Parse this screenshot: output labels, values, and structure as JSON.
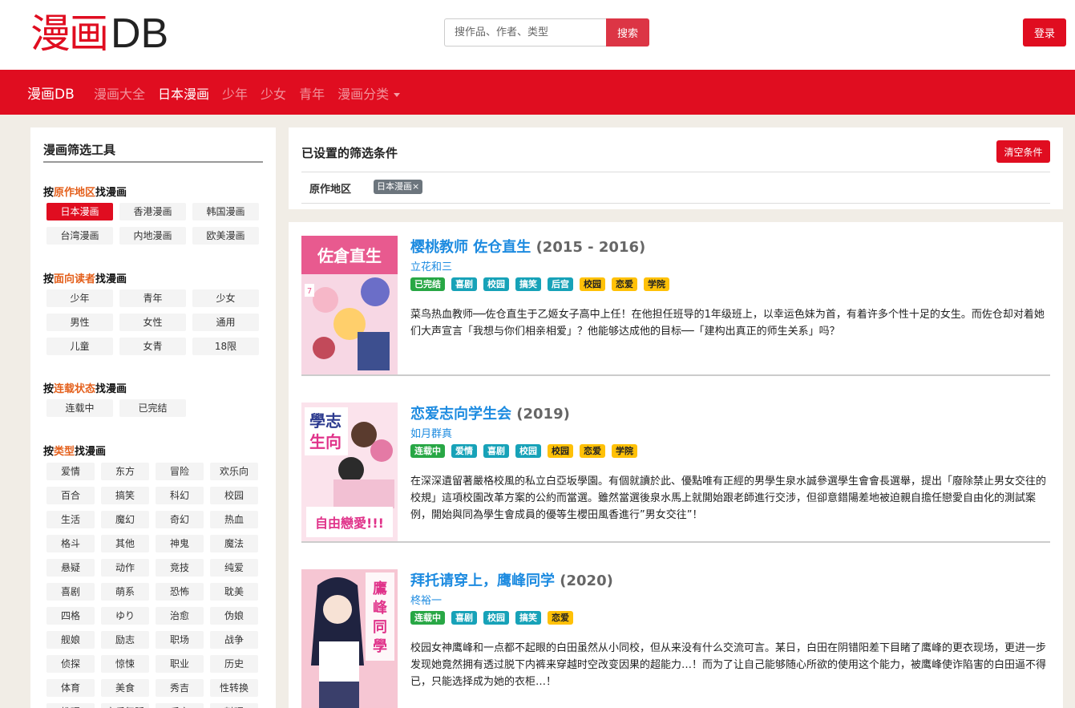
{
  "header": {
    "logo_cn": "漫画",
    "logo_en": "DB",
    "search_placeholder": "搜作品、作者、类型",
    "search_button": "搜索",
    "login_button": "登录"
  },
  "navbar": {
    "brand": "漫画DB",
    "links": [
      {
        "label": "漫画大全",
        "active": false
      },
      {
        "label": "日本漫画",
        "active": true
      },
      {
        "label": "少年",
        "active": false
      },
      {
        "label": "少女",
        "active": false
      },
      {
        "label": "青年",
        "active": false
      },
      {
        "label": "漫画分类",
        "active": false
      }
    ]
  },
  "sidebar": {
    "title": "漫画筛选工具",
    "region": {
      "prefix": "按",
      "keyword": "原作地区",
      "suffix": "找漫画",
      "tags": [
        "日本漫画",
        "香港漫画",
        "韩国漫画",
        "台湾漫画",
        "内地漫画",
        "欧美漫画"
      ],
      "selected": "日本漫画"
    },
    "audience": {
      "prefix": "按",
      "keyword": "面向读者",
      "suffix": "找漫画",
      "tags": [
        "少年",
        "青年",
        "少女",
        "男性",
        "女性",
        "通用",
        "儿童",
        "女青",
        "18限"
      ]
    },
    "status": {
      "prefix": "按",
      "keyword": "连载状态",
      "suffix": "找漫画",
      "tags": [
        "连载中",
        "已完结"
      ]
    },
    "genre": {
      "prefix": "按",
      "keyword": "类型",
      "suffix": "找漫画",
      "tags": [
        "爱情",
        "东方",
        "冒险",
        "欢乐向",
        "百合",
        "搞笑",
        "科幻",
        "校园",
        "生活",
        "魔幻",
        "奇幻",
        "热血",
        "格斗",
        "其他",
        "神鬼",
        "魔法",
        "悬疑",
        "动作",
        "竞技",
        "纯爱",
        "喜剧",
        "萌系",
        "恐怖",
        "耽美",
        "四格",
        "ゆり",
        "治愈",
        "伪娘",
        "舰娘",
        "励志",
        "职场",
        "战争",
        "侦探",
        "惊悚",
        "职业",
        "历史",
        "体育",
        "美食",
        "秀吉",
        "性转换",
        "推理",
        "音乐舞蹈",
        "后宫",
        "料理"
      ]
    }
  },
  "filter": {
    "title": "已设置的筛选条件",
    "clear_button": "清空条件",
    "label": "原作地区",
    "chip": "日本漫画×"
  },
  "results": [
    {
      "title": "樱桃教师 佐仓直生",
      "year": "(2015 - 2016)",
      "author": "立花和三",
      "badges": [
        {
          "text": "已完结",
          "color": "green"
        },
        {
          "text": "喜剧",
          "color": "teal"
        },
        {
          "text": "校园",
          "color": "teal"
        },
        {
          "text": "搞笑",
          "color": "teal"
        },
        {
          "text": "后宫",
          "color": "teal"
        },
        {
          "text": "校园",
          "color": "yellow"
        },
        {
          "text": "恋爱",
          "color": "yellow"
        },
        {
          "text": "学院",
          "color": "yellow"
        }
      ],
      "description": "菜鸟热血教师──佐仓直生于乙姬女子高中上任！在他担任班导的1年级班上，以幸运色妹为首，有着许多个性十足的女生。而佐仓却对着她们大声宣言「我想与你们相亲相爱」？他能够达成他的目标──「建构出真正的师生关系」吗？"
    },
    {
      "title": "恋爱志向学生会",
      "year": "(2019)",
      "author": "如月群真",
      "badges": [
        {
          "text": "连载中",
          "color": "green"
        },
        {
          "text": "爱情",
          "color": "teal"
        },
        {
          "text": "喜剧",
          "color": "teal"
        },
        {
          "text": "校园",
          "color": "teal"
        },
        {
          "text": "校园",
          "color": "yellow"
        },
        {
          "text": "恋爱",
          "color": "yellow"
        },
        {
          "text": "学院",
          "color": "yellow"
        }
      ],
      "description": "在深深遺留著嚴格校風的私立白亞坂學園。有個就讀於此、優點唯有正經的男學生泉水誠參選學生會會長選舉，提出「廢除禁止男女交往的校規」這項校園改革方案的公約而當選。雖然當選後泉水馬上就開始跟老師進行交涉，但卻意錯陽差地被迫親自擔任戀愛自由化的測試案例，開始與同為學生會成員的優等生櫻田風香進行”男女交往”！"
    },
    {
      "title": "拜托请穿上，鹰峰同学",
      "year": "(2020)",
      "author": "柊裕一",
      "badges": [
        {
          "text": "连载中",
          "color": "green"
        },
        {
          "text": "喜剧",
          "color": "teal"
        },
        {
          "text": "校园",
          "color": "teal"
        },
        {
          "text": "搞笑",
          "color": "teal"
        },
        {
          "text": "恋爱",
          "color": "yellow"
        }
      ],
      "description": "校园女神鹰峰和一点都不起眼的白田虽然从小同校，但从来没有什么交流可言。某日，白田在阴错阳差下目睹了鹰峰的更衣现场，更进一步发现她竟然拥有透过脱下内裤来穿越时空改变因果的超能力…！而为了让自己能够随心所欲的使用这个能力，被鹰峰使诈陷害的白田逼不得已，只能选择成为她的衣柜…！"
    }
  ]
}
